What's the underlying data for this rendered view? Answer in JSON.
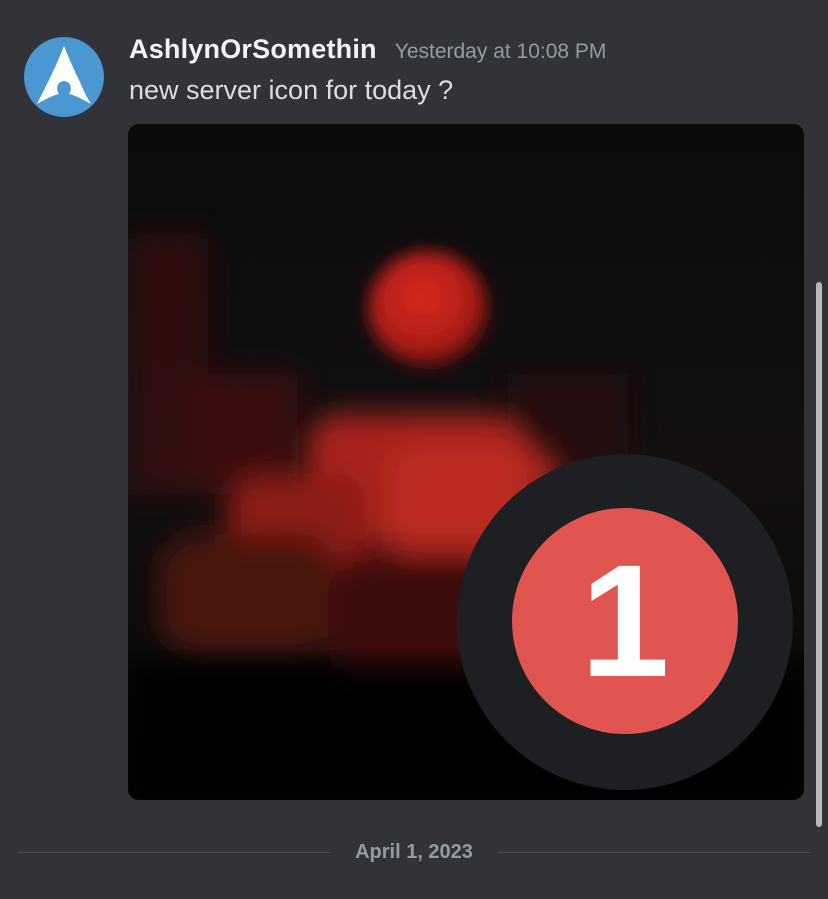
{
  "message": {
    "username": "AshlynOrSomethin",
    "timestamp": "Yesterday at 10:08 PM",
    "content": "new server icon for today ?",
    "avatar_icon": "arch-linux-logo",
    "attachment_icon": "dark-clouds-red-moon-image"
  },
  "badge": {
    "count": "1"
  },
  "divider": {
    "date": "April 1, 2023"
  },
  "colors": {
    "background": "#313338",
    "username": "#f2f3f5",
    "timestamp": "#949ba4",
    "content": "#dbdee1",
    "avatar": "#4a97d2",
    "badge": "#e05550",
    "badge_ring": "#1e1f22"
  }
}
